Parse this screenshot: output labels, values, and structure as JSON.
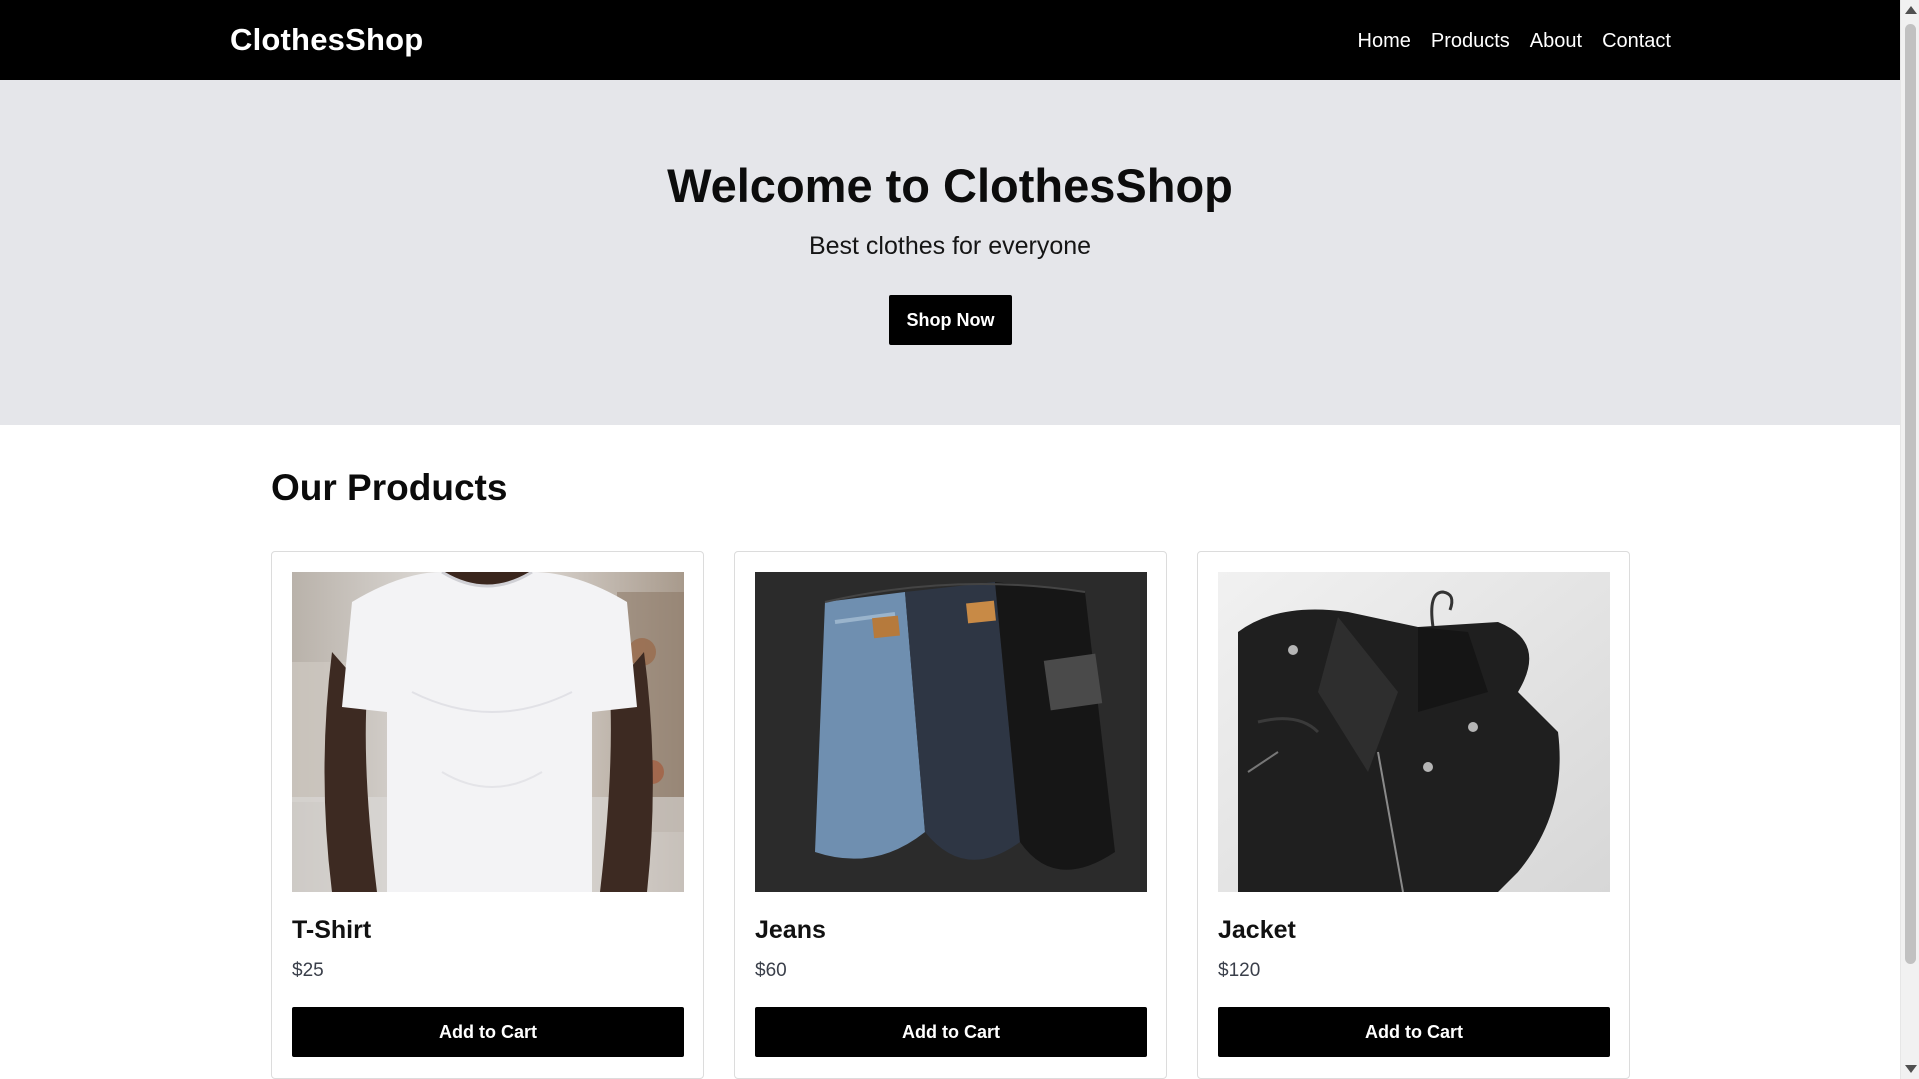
{
  "header": {
    "brand": "ClothesShop",
    "nav": [
      "Home",
      "Products",
      "About",
      "Contact"
    ]
  },
  "hero": {
    "title": "Welcome to ClothesShop",
    "subtitle": "Best clothes for everyone",
    "cta_label": "Shop Now"
  },
  "products": {
    "section_title": "Our Products",
    "items": [
      {
        "name": "T-Shirt",
        "price": "$25",
        "button_label": "Add to Cart",
        "image": "white-tshirt-photo"
      },
      {
        "name": "Jeans",
        "price": "$60",
        "button_label": "Add to Cart",
        "image": "folded-jeans-photo"
      },
      {
        "name": "Jacket",
        "price": "$120",
        "button_label": "Add to Cart",
        "image": "leather-jacket-photo"
      }
    ]
  },
  "colors": {
    "header_bg": "#000000",
    "hero_bg": "#e5e6ea",
    "button_bg": "#000000",
    "price_text": "#3a3f4a"
  }
}
